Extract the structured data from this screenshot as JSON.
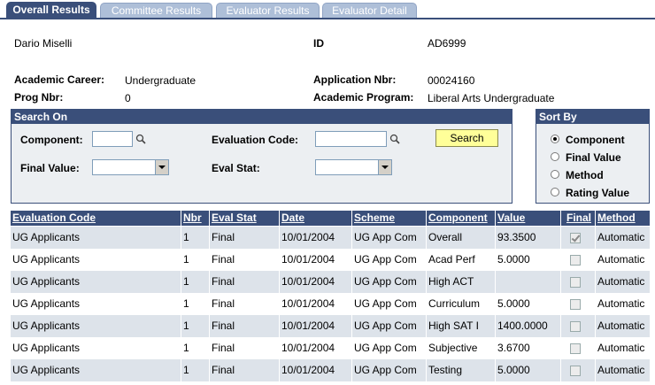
{
  "tabs": [
    {
      "label": "Overall Results",
      "active": true
    },
    {
      "label": "Committee Results",
      "active": false
    },
    {
      "label": "Evaluator Results",
      "active": false
    },
    {
      "label": "Evaluator Detail",
      "active": false
    }
  ],
  "header": {
    "name": "Dario Miselli",
    "id_label": "ID",
    "id_value": "AD6999",
    "career_label": "Academic Career:",
    "career_value": "Undergraduate",
    "appl_label": "Application Nbr:",
    "appl_value": "00024160",
    "prog_label": "Prog Nbr:",
    "prog_value": "0",
    "program_label": "Academic Program:",
    "program_value": "Liberal Arts Undergraduate"
  },
  "search": {
    "title": "Search On",
    "component_label": "Component:",
    "component_value": "",
    "eval_code_label": "Evaluation Code:",
    "eval_code_value": "",
    "final_value_label": "Final Value:",
    "final_value_selected": "",
    "eval_stat_label": "Eval Stat:",
    "eval_stat_selected": "",
    "search_button": "Search"
  },
  "sort": {
    "title": "Sort By",
    "options": [
      {
        "label": "Component",
        "selected": true
      },
      {
        "label": "Final Value",
        "selected": false
      },
      {
        "label": "Method",
        "selected": false
      },
      {
        "label": "Rating Value",
        "selected": false
      }
    ]
  },
  "grid": {
    "columns": [
      "Evaluation Code",
      "Nbr",
      "Eval Stat",
      "Date",
      "Scheme",
      "Component",
      "Value",
      "Final",
      "Method"
    ],
    "rows": [
      {
        "code": "UG Applicants",
        "nbr": "1",
        "stat": "Final",
        "date": "10/01/2004",
        "scheme": "UG App Com",
        "component": "Overall",
        "value": "93.3500",
        "final": true,
        "method": "Automatic"
      },
      {
        "code": "UG Applicants",
        "nbr": "1",
        "stat": "Final",
        "date": "10/01/2004",
        "scheme": "UG App Com",
        "component": "Acad Perf",
        "value": "5.0000",
        "final": false,
        "method": "Automatic"
      },
      {
        "code": "UG Applicants",
        "nbr": "1",
        "stat": "Final",
        "date": "10/01/2004",
        "scheme": "UG App Com",
        "component": "High ACT",
        "value": "",
        "final": false,
        "method": "Automatic"
      },
      {
        "code": "UG Applicants",
        "nbr": "1",
        "stat": "Final",
        "date": "10/01/2004",
        "scheme": "UG App Com",
        "component": "Curriculum",
        "value": "5.0000",
        "final": false,
        "method": "Automatic"
      },
      {
        "code": "UG Applicants",
        "nbr": "1",
        "stat": "Final",
        "date": "10/01/2004",
        "scheme": "UG App Com",
        "component": "High SAT I",
        "value": "1400.0000",
        "final": false,
        "method": "Automatic"
      },
      {
        "code": "UG Applicants",
        "nbr": "1",
        "stat": "Final",
        "date": "10/01/2004",
        "scheme": "UG App Com",
        "component": "Subjective",
        "value": "3.6700",
        "final": false,
        "method": "Automatic"
      },
      {
        "code": "UG Applicants",
        "nbr": "1",
        "stat": "Final",
        "date": "10/01/2004",
        "scheme": "UG App Com",
        "component": "Testing",
        "value": "5.0000",
        "final": false,
        "method": "Automatic"
      }
    ]
  }
}
